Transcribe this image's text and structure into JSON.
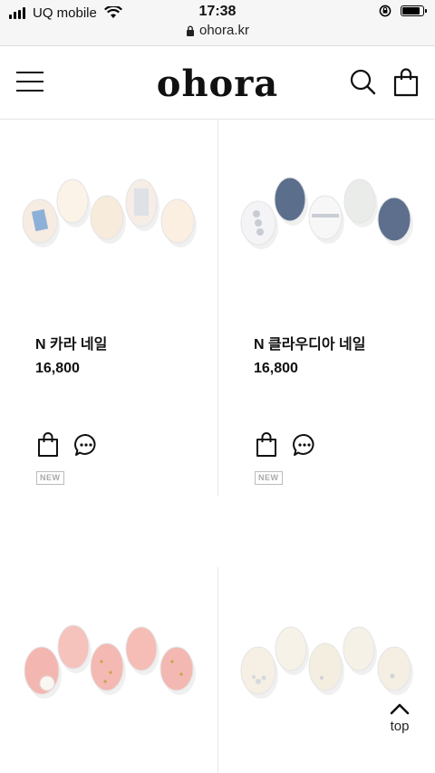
{
  "status_bar": {
    "carrier": "UQ mobile",
    "time": "17:38",
    "url": "ohora.kr"
  },
  "header": {
    "logo": "ohora"
  },
  "products": [
    {
      "name": "N 카라 네일",
      "price": "16,800",
      "badge": "NEW",
      "palette": [
        "#f6ece2",
        "#fbf2e8",
        "#f7ebdc",
        "#f5ede6",
        "#fbefe2"
      ]
    },
    {
      "name": "N 클라우디아 네일",
      "price": "16,800",
      "badge": "NEW",
      "palette": [
        "#f4f4f6",
        "#5b6e8c",
        "#f7f7f8",
        "#e9ece9",
        "#5d6f8d"
      ]
    },
    {
      "name": "",
      "price": "",
      "badge": "",
      "palette": [
        "#f4b6b0",
        "#f6c2bc",
        "#f4b9b2",
        "#f5bdb6",
        "#f3b8b1"
      ]
    },
    {
      "name": "",
      "price": "",
      "badge": "",
      "palette": [
        "#f5efe4",
        "#f7f2e7",
        "#f4eee1",
        "#f6f1e6",
        "#f5eee3"
      ]
    }
  ],
  "back_to_top": {
    "label": "top"
  },
  "colors": {
    "text": "#111111",
    "divider": "#e8e8e8",
    "badge": "#aaaaaa"
  },
  "icons": [
    "signal-icon",
    "wifi-icon",
    "lock-icon",
    "rotation-lock-icon",
    "battery-icon",
    "menu-icon",
    "search-icon",
    "shopping-bag-icon",
    "chat-icon",
    "chevron-up-icon"
  ]
}
